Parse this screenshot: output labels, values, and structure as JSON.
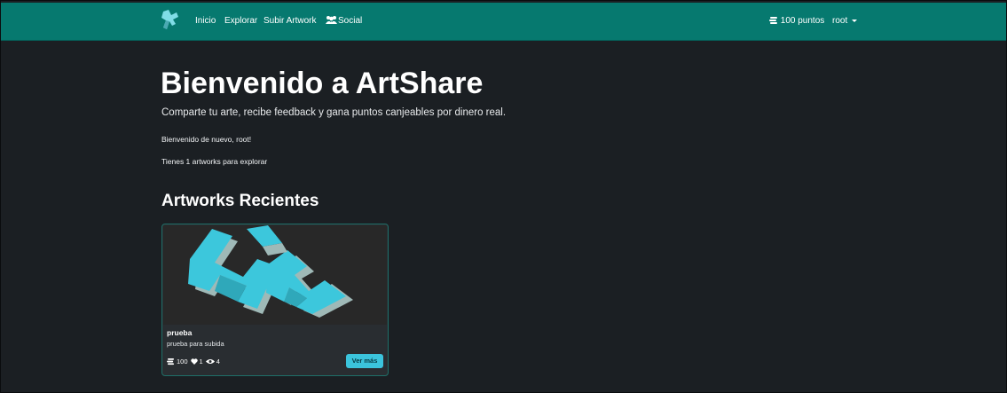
{
  "nav": {
    "links": [
      {
        "label": "Inicio"
      },
      {
        "label": "Explorar"
      },
      {
        "label": "Subir Artwork"
      },
      {
        "label": "Social",
        "icon": "users-icon"
      }
    ],
    "points": "100 puntos",
    "user": "root",
    "colors": {
      "navbar": "#06796f",
      "background": "#1b1f23"
    }
  },
  "hero": {
    "title": "Bienvenido a ArtShare",
    "lead": "Comparte tu arte, recibe feedback y gana puntos canjeables por dinero real.",
    "welcome": "Bienvenido de nuevo, root!",
    "count": "Tienes 1 artworks para explorar"
  },
  "section": {
    "title": "Artworks Recientes"
  },
  "artworks": [
    {
      "title": "prueba",
      "description": "prueba para subida",
      "stats": {
        "points": "100",
        "likes": "1",
        "views": "4"
      },
      "button": "Ver más",
      "accent": "#3bc4dc"
    }
  ]
}
